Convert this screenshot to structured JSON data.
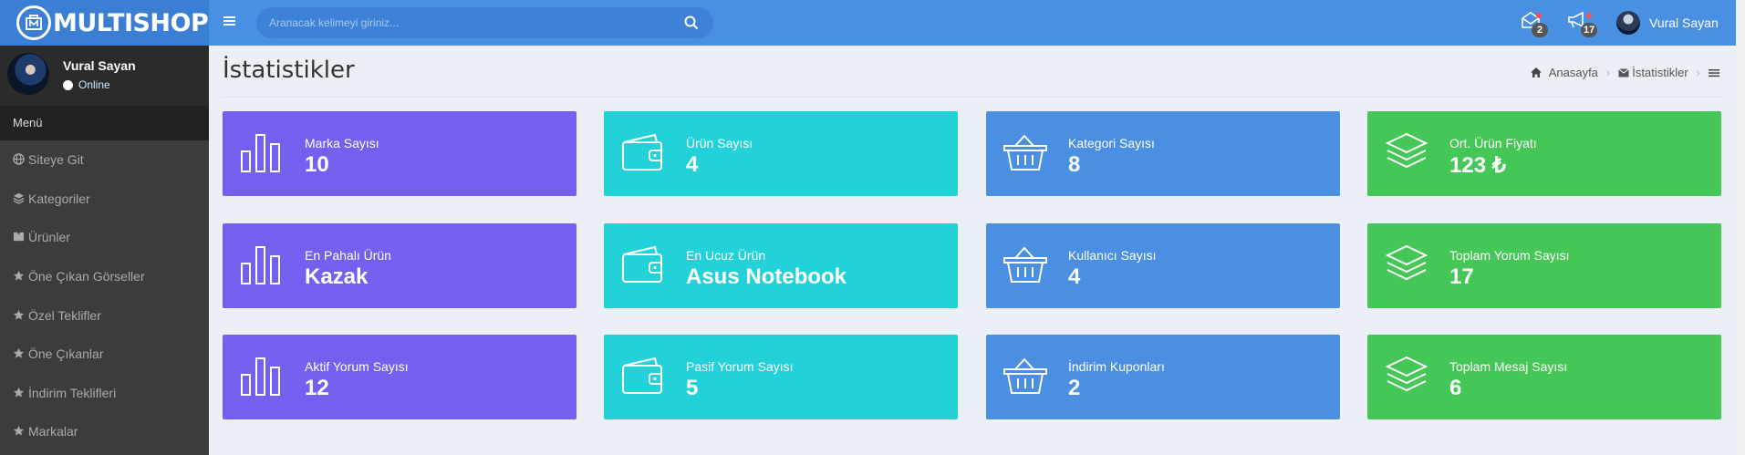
{
  "brand": {
    "logo_text": "MULTISHOP"
  },
  "search": {
    "placeholder": "Aranacak kelimeyi giriniz..."
  },
  "notifications": {
    "messages_count": "2",
    "announcements_count": "17"
  },
  "user": {
    "name": "Vural Sayan",
    "status": "Online"
  },
  "sidebar": {
    "menu_header": "Menü",
    "items": [
      {
        "label": "Siteye Git",
        "icon": "globe-icon"
      },
      {
        "label": "Kategoriler",
        "icon": "layers-icon"
      },
      {
        "label": "Ürünler",
        "icon": "boxes-icon"
      },
      {
        "label": "Öne Çıkan Görseller",
        "icon": "star-icon"
      },
      {
        "label": "Özel Teklifler",
        "icon": "star-icon"
      },
      {
        "label": "Öne Çıkanlar",
        "icon": "star-icon"
      },
      {
        "label": "İndirim Teklifleri",
        "icon": "star-icon"
      },
      {
        "label": "Markalar",
        "icon": "star-icon"
      }
    ]
  },
  "page": {
    "title": "İstatistikler"
  },
  "breadcrumb": {
    "home": "Anasayfa",
    "current": "İstatistikler"
  },
  "colors": {
    "purple": "#7161ee",
    "cyan": "#23d2d9",
    "blue": "#4a8fe2",
    "green": "#44c756",
    "topbar": "#4a90e2",
    "sidebar": "#3c3c3c"
  },
  "cards": [
    {
      "label": "Marka Sayısı",
      "value": "10",
      "icon": "bar-chart-icon"
    },
    {
      "label": "Ürün Sayısı",
      "value": "4",
      "icon": "wallet-icon"
    },
    {
      "label": "Kategori Sayısı",
      "value": "8",
      "icon": "basket-icon"
    },
    {
      "label": "Ort. Ürün Fiyatı",
      "value": "123 ₺",
      "icon": "layers-icon"
    },
    {
      "label": "En Pahalı Ürün",
      "value": "Kazak",
      "icon": "bar-chart-icon"
    },
    {
      "label": "En Ucuz Ürün",
      "value": "Asus Notebook",
      "icon": "wallet-icon"
    },
    {
      "label": "Kullanıcı Sayısı",
      "value": "4",
      "icon": "basket-icon"
    },
    {
      "label": "Toplam Yorum Sayısı",
      "value": "17",
      "icon": "layers-icon"
    },
    {
      "label": "Aktif Yorum Sayısı",
      "value": "12",
      "icon": "bar-chart-icon"
    },
    {
      "label": "Pasif Yorum Sayısı",
      "value": "5",
      "icon": "wallet-icon"
    },
    {
      "label": "İndirim Kuponları",
      "value": "2",
      "icon": "basket-icon"
    },
    {
      "label": "Toplam Mesaj Sayısı",
      "value": "6",
      "icon": "layers-icon"
    }
  ]
}
